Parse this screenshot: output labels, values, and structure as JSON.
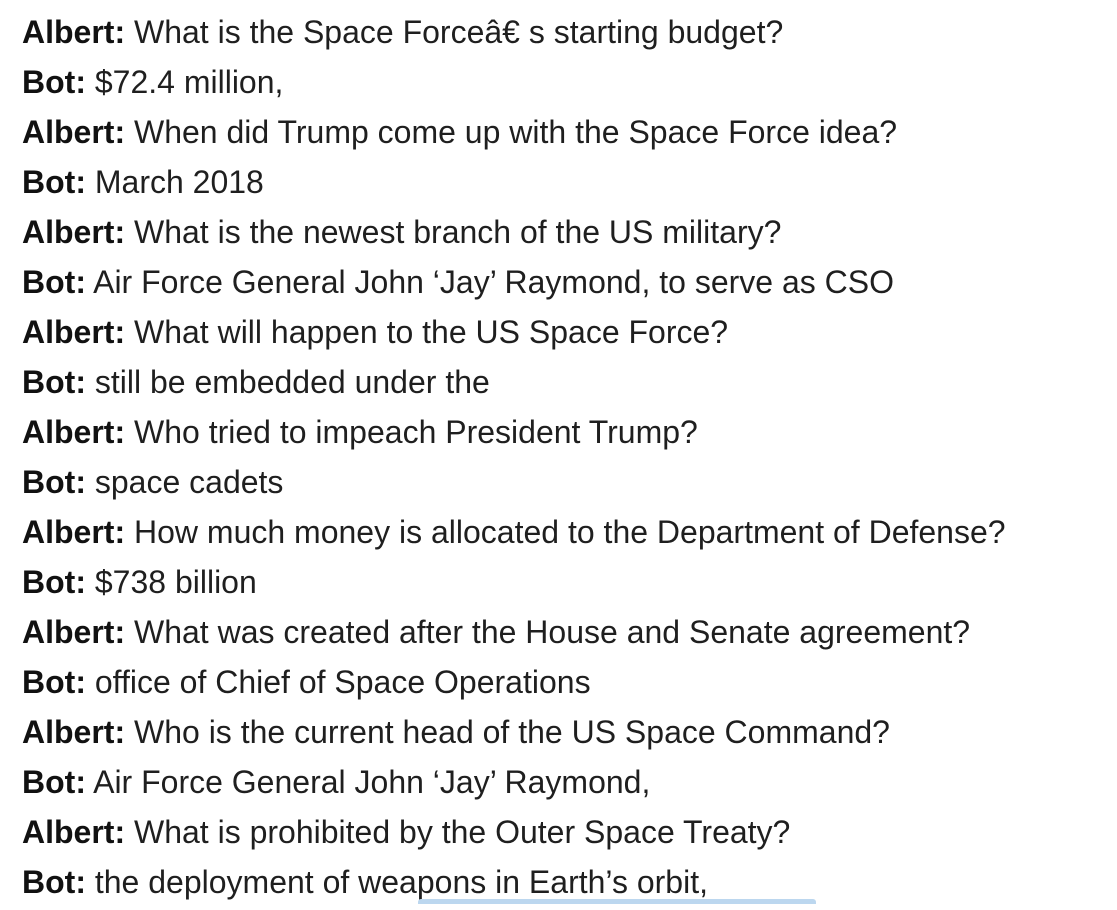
{
  "speakers": {
    "user": "Albert:",
    "bot": "Bot:"
  },
  "transcript": [
    {
      "speaker": "Albert:",
      "text": "What is the Space Forceâ€   s starting budget?"
    },
    {
      "speaker": "Bot:",
      "text": "$72.4 million,"
    },
    {
      "speaker": "Albert:",
      "text": "When did Trump come up with the Space Force idea?"
    },
    {
      "speaker": "Bot:",
      "text": "March 2018"
    },
    {
      "speaker": "Albert:",
      "text": "What is the newest branch of the US military?"
    },
    {
      "speaker": "Bot:",
      "text": "Air Force General John ‘Jay’ Raymond, to serve as CSO"
    },
    {
      "speaker": "Albert:",
      "text": "What will happen to the US Space Force?"
    },
    {
      "speaker": "Bot:",
      "text": "still be embedded under the"
    },
    {
      "speaker": "Albert:",
      "text": "Who tried to impeach President Trump?"
    },
    {
      "speaker": "Bot:",
      "text": "space cadets"
    },
    {
      "speaker": "Albert:",
      "text": "How much money is allocated to the Department of Defense?"
    },
    {
      "speaker": "Bot:",
      "text": "$738 billion"
    },
    {
      "speaker": "Albert:",
      "text": "What was created after the House and Senate agreement?"
    },
    {
      "speaker": "Bot:",
      "text": "office of Chief of Space Operations"
    },
    {
      "speaker": "Albert:",
      "text": "Who is the current head of the US Space Command?"
    },
    {
      "speaker": "Bot:",
      "text": "Air Force General John ‘Jay’ Raymond,"
    },
    {
      "speaker": "Albert:",
      "text": "What is prohibited by the Outer Space Treaty?"
    },
    {
      "speaker": "Bot:",
      "text": "the deployment of weapons in Earth’s orbit,"
    }
  ],
  "colors": {
    "text": "#1f1f1f",
    "speaker": "#111111",
    "background": "#ffffff",
    "selection_bar": "#bcd7ef"
  }
}
